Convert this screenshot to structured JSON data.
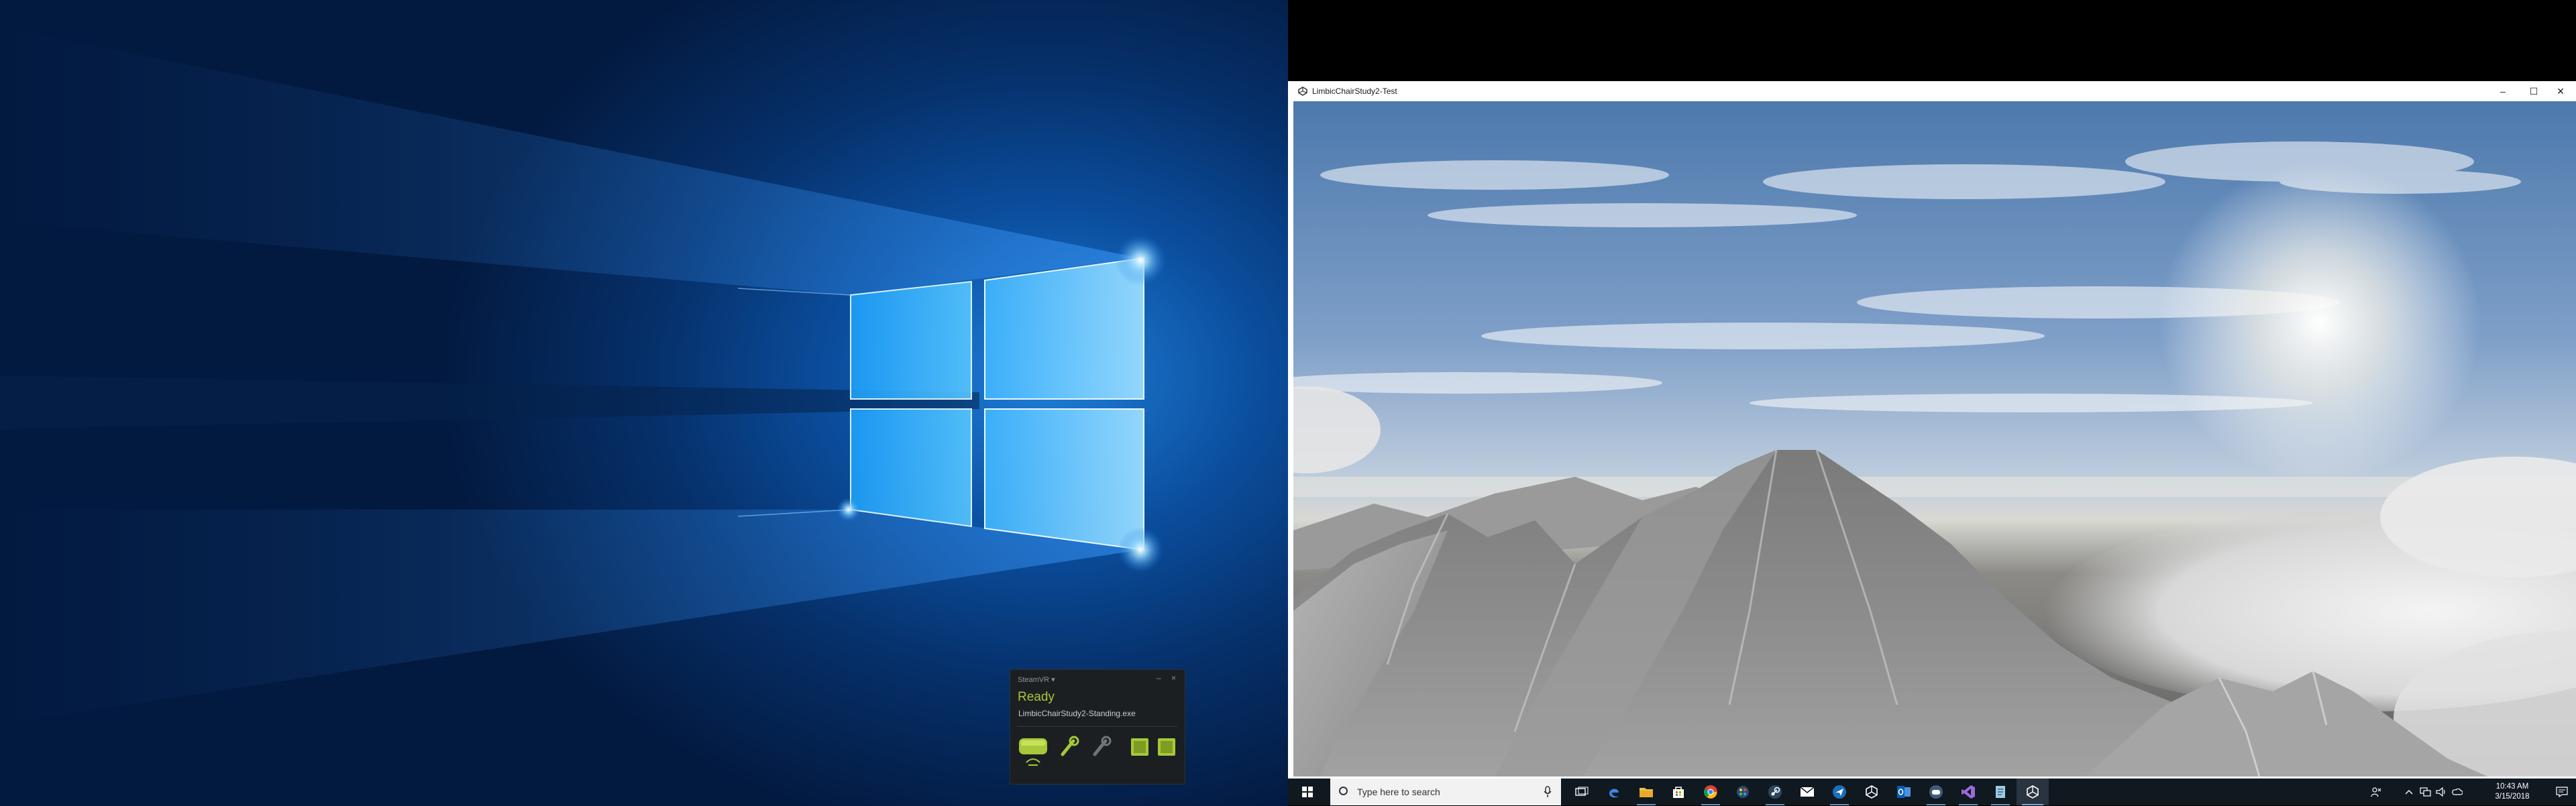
{
  "desktop_left": {
    "wallpaper": "windows-10-hero",
    "steamvr": {
      "title": "SteamVR ▾",
      "minimize": "–",
      "close": "×",
      "status": "Ready",
      "app": "LimbicChairStudy2-Standing.exe",
      "device_icons": [
        "headset-icon",
        "controller-icon",
        "controller-icon",
        "base-station-icon",
        "base-station-icon"
      ],
      "accent": "#a6c83a"
    }
  },
  "window": {
    "title": "LimbicChairStudy2-Test",
    "controls": {
      "minimize": "–",
      "maximize": "☐",
      "close": "✕"
    },
    "scene": "snowy-mountain-peak-under-sky"
  },
  "taskbar": {
    "search_placeholder": "Type here to search",
    "pinned": [
      "task-view-icon",
      "edge-icon",
      "file-explorer-icon",
      "store-icon",
      "chrome-icon",
      "paint-icon",
      "steam-icon",
      "mail-icon",
      "steam-icon",
      "unity-icon",
      "outlook-icon",
      "steamvr-icon",
      "visual-studio-icon",
      "notepad-icon",
      "unity-icon"
    ],
    "clock": {
      "time": "10:43 AM",
      "date": "3/15/2018"
    },
    "colors": {
      "bar": "#101820",
      "indicator": "#7aa9d6"
    }
  }
}
